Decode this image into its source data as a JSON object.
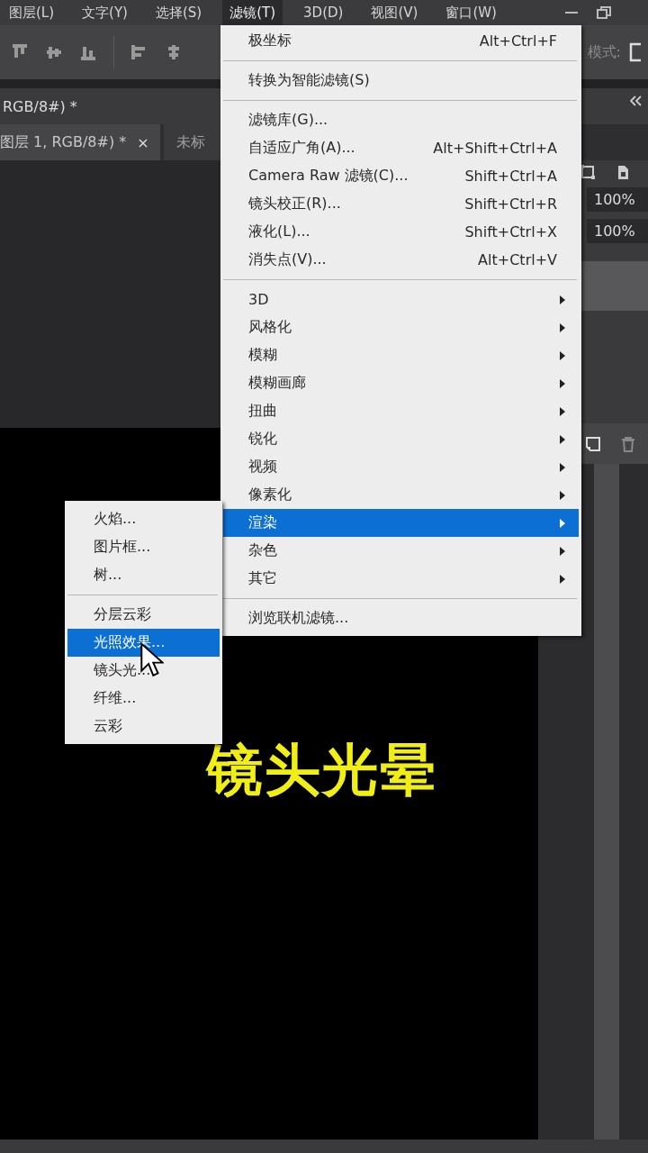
{
  "menubar": {
    "items": [
      {
        "label": "图层(L)",
        "selected": false
      },
      {
        "label": "文字(Y)",
        "selected": false
      },
      {
        "label": "选择(S)",
        "selected": false
      },
      {
        "label": "滤镜(T)",
        "selected": true
      },
      {
        "label": "3D(D)",
        "selected": false
      },
      {
        "label": "视图(V)",
        "selected": false
      },
      {
        "label": "窗口(W)",
        "selected": false
      }
    ]
  },
  "options_bar": {
    "mode_label": "模式:"
  },
  "document_title": "RGB/8#) *",
  "tabs": [
    {
      "label": "图层 1, RGB/8#) *",
      "selected": true,
      "close": "×"
    },
    {
      "label": "未标",
      "selected": false
    }
  ],
  "layers_panel": {
    "fields": [
      "100%",
      "100%"
    ]
  },
  "canvas": {
    "caption": "镜头光晕"
  },
  "filter_menu": {
    "items": [
      {
        "kind": "item",
        "label": "极坐标",
        "shortcut": "Alt+Ctrl+F"
      },
      {
        "kind": "separator"
      },
      {
        "kind": "item",
        "label": "转换为智能滤镜(S)"
      },
      {
        "kind": "separator"
      },
      {
        "kind": "item",
        "label": "滤镜库(G)..."
      },
      {
        "kind": "item",
        "label": "自适应广角(A)...",
        "shortcut": "Alt+Shift+Ctrl+A"
      },
      {
        "kind": "item",
        "label": "Camera Raw 滤镜(C)...",
        "shortcut": "Shift+Ctrl+A"
      },
      {
        "kind": "item",
        "label": "镜头校正(R)...",
        "shortcut": "Shift+Ctrl+R"
      },
      {
        "kind": "item",
        "label": "液化(L)...",
        "shortcut": "Shift+Ctrl+X"
      },
      {
        "kind": "item",
        "label": "消失点(V)...",
        "shortcut": "Alt+Ctrl+V"
      },
      {
        "kind": "separator"
      },
      {
        "kind": "submenu",
        "label": "3D",
        "selected": false
      },
      {
        "kind": "submenu",
        "label": "风格化",
        "selected": false
      },
      {
        "kind": "submenu",
        "label": "模糊",
        "selected": false
      },
      {
        "kind": "submenu",
        "label": "模糊画廊",
        "selected": false
      },
      {
        "kind": "submenu",
        "label": "扭曲",
        "selected": false
      },
      {
        "kind": "submenu",
        "label": "锐化",
        "selected": false
      },
      {
        "kind": "submenu",
        "label": "视频",
        "selected": false
      },
      {
        "kind": "submenu",
        "label": "像素化",
        "selected": false
      },
      {
        "kind": "submenu",
        "label": "渲染",
        "selected": true
      },
      {
        "kind": "submenu",
        "label": "杂色",
        "selected": false
      },
      {
        "kind": "submenu",
        "label": "其它",
        "selected": false
      },
      {
        "kind": "separator"
      },
      {
        "kind": "item",
        "label": "浏览联机滤镜..."
      }
    ]
  },
  "render_submenu": {
    "items": [
      {
        "kind": "item",
        "label": "火焰...",
        "selected": false
      },
      {
        "kind": "item",
        "label": "图片框...",
        "selected": false
      },
      {
        "kind": "item",
        "label": "树...",
        "selected": false
      },
      {
        "kind": "separator"
      },
      {
        "kind": "item",
        "label": "分层云彩",
        "selected": false
      },
      {
        "kind": "item",
        "label": "光照效果...",
        "selected": true
      },
      {
        "kind": "item",
        "label": "镜头光...",
        "selected": false
      },
      {
        "kind": "item",
        "label": "纤维...",
        "selected": false
      },
      {
        "kind": "item",
        "label": "云彩",
        "selected": false
      }
    ]
  }
}
